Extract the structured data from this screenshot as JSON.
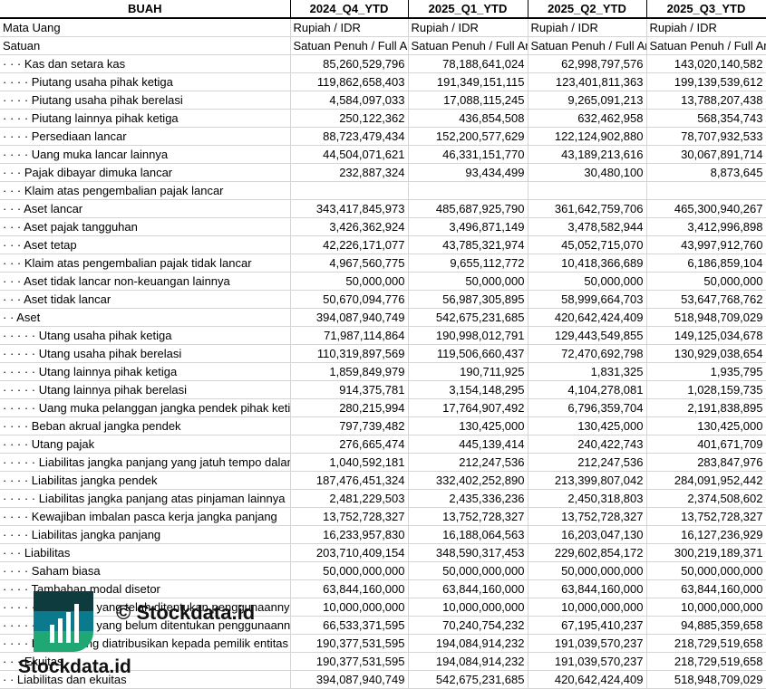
{
  "header": {
    "label": "BUAH",
    "periods": [
      "2024_Q4_YTD",
      "2025_Q1_YTD",
      "2025_Q2_YTD",
      "2025_Q3_YTD"
    ]
  },
  "meta_rows": [
    {
      "label": "Mata Uang",
      "values": [
        "Rupiah / IDR",
        "Rupiah / IDR",
        "Rupiah / IDR",
        "Rupiah / IDR"
      ]
    },
    {
      "label": "Satuan",
      "values": [
        "Satuan Penuh / Full Amount",
        "Satuan Penuh / Full Amount",
        "Satuan Penuh / Full Amount",
        "Satuan Penuh / Full Amount"
      ]
    }
  ],
  "rows": [
    {
      "label": "· · · Kas dan setara kas",
      "values": [
        "85,260,529,796",
        "78,188,641,024",
        "62,998,797,576",
        "143,020,140,582"
      ]
    },
    {
      "label": "· · · · Piutang usaha pihak ketiga",
      "values": [
        "119,862,658,403",
        "191,349,151,115",
        "123,401,811,363",
        "199,139,539,612"
      ]
    },
    {
      "label": "· · · · Piutang usaha pihak berelasi",
      "values": [
        "4,584,097,033",
        "17,088,115,245",
        "9,265,091,213",
        "13,788,207,438"
      ]
    },
    {
      "label": "· · · · Piutang lainnya pihak ketiga",
      "values": [
        "250,122,362",
        "436,854,508",
        "632,462,958",
        "568,354,743"
      ]
    },
    {
      "label": "· · · · Persediaan lancar",
      "values": [
        "88,723,479,434",
        "152,200,577,629",
        "122,124,902,880",
        "78,707,932,533"
      ]
    },
    {
      "label": "· · · · Uang muka lancar lainnya",
      "values": [
        "44,504,071,621",
        "46,331,151,770",
        "43,189,213,616",
        "30,067,891,714"
      ]
    },
    {
      "label": "· · · Pajak dibayar dimuka lancar",
      "values": [
        "232,887,324",
        "93,434,499",
        "30,480,100",
        "8,873,645"
      ]
    },
    {
      "label": "· · · Klaim atas pengembalian pajak lancar",
      "values": [
        "",
        "",
        "",
        ""
      ]
    },
    {
      "label": "· · · Aset lancar",
      "values": [
        "343,417,845,973",
        "485,687,925,790",
        "361,642,759,706",
        "465,300,940,267"
      ]
    },
    {
      "label": "· · · Aset pajak tangguhan",
      "values": [
        "3,426,362,924",
        "3,496,871,149",
        "3,478,582,944",
        "3,412,996,898"
      ]
    },
    {
      "label": "· · · Aset tetap",
      "values": [
        "42,226,171,077",
        "43,785,321,974",
        "45,052,715,070",
        "43,997,912,760"
      ]
    },
    {
      "label": "· · · Klaim atas pengembalian pajak tidak lancar",
      "values": [
        "4,967,560,775",
        "9,655,112,772",
        "10,418,366,689",
        "6,186,859,104"
      ]
    },
    {
      "label": "· · · Aset tidak lancar non-keuangan lainnya",
      "values": [
        "50,000,000",
        "50,000,000",
        "50,000,000",
        "50,000,000"
      ]
    },
    {
      "label": "· · · Aset tidak lancar",
      "values": [
        "50,670,094,776",
        "56,987,305,895",
        "58,999,664,703",
        "53,647,768,762"
      ]
    },
    {
      "label": "· · Aset",
      "values": [
        "394,087,940,749",
        "542,675,231,685",
        "420,642,424,409",
        "518,948,709,029"
      ]
    },
    {
      "label": "· · · · · Utang usaha pihak ketiga",
      "values": [
        "71,987,114,864",
        "190,998,012,791",
        "129,443,549,855",
        "149,125,034,678"
      ]
    },
    {
      "label": "· · · · · Utang usaha pihak berelasi",
      "values": [
        "110,319,897,569",
        "119,506,660,437",
        "72,470,692,798",
        "130,929,038,654"
      ]
    },
    {
      "label": "· · · · · Utang lainnya pihak ketiga",
      "values": [
        "1,859,849,979",
        "190,711,925",
        "1,831,325",
        "1,935,795"
      ]
    },
    {
      "label": "· · · · · Utang lainnya pihak berelasi",
      "values": [
        "914,375,781",
        "3,154,148,295",
        "4,104,278,081",
        "1,028,159,735"
      ]
    },
    {
      "label": "· · · · · Uang muka pelanggan jangka pendek pihak ketiga",
      "values": [
        "280,215,994",
        "17,764,907,492",
        "6,796,359,704",
        "2,191,838,895"
      ]
    },
    {
      "label": "· · · · Beban akrual jangka pendek",
      "values": [
        "797,739,482",
        "130,425,000",
        "130,425,000",
        "130,425,000"
      ]
    },
    {
      "label": "· · · · Utang pajak",
      "values": [
        "276,665,474",
        "445,139,414",
        "240,422,743",
        "401,671,709"
      ]
    },
    {
      "label": "· · · · · Liabilitas jangka panjang yang jatuh tempo dalam satu tahun",
      "values": [
        "1,040,592,181",
        "212,247,536",
        "212,247,536",
        "283,847,976"
      ]
    },
    {
      "label": "· · · · Liabilitas jangka pendek",
      "values": [
        "187,476,451,324",
        "332,402,252,890",
        "213,399,807,042",
        "284,091,952,442"
      ]
    },
    {
      "label": "· · · · · Liabilitas jangka panjang atas pinjaman lainnya",
      "values": [
        "2,481,229,503",
        "2,435,336,236",
        "2,450,318,803",
        "2,374,508,602"
      ]
    },
    {
      "label": "· · · · Kewajiban imbalan pasca kerja jangka panjang",
      "values": [
        "13,752,728,327",
        "13,752,728,327",
        "13,752,728,327",
        "13,752,728,327"
      ]
    },
    {
      "label": "· · · · Liabilitas jangka panjang",
      "values": [
        "16,233,957,830",
        "16,188,064,563",
        "16,203,047,130",
        "16,127,236,929"
      ]
    },
    {
      "label": "· · · Liabilitas",
      "values": [
        "203,710,409,154",
        "348,590,317,453",
        "229,602,854,172",
        "300,219,189,371"
      ]
    },
    {
      "label": "· · · · Saham biasa",
      "values": [
        "50,000,000,000",
        "50,000,000,000",
        "50,000,000,000",
        "50,000,000,000"
      ]
    },
    {
      "label": "· · · · Tambahan modal disetor",
      "values": [
        "63,844,160,000",
        "63,844,160,000",
        "63,844,160,000",
        "63,844,160,000"
      ]
    },
    {
      "label": "· · · · · Cadangan yang telah ditentukan penggunaannya",
      "values": [
        "10,000,000,000",
        "10,000,000,000",
        "10,000,000,000",
        "10,000,000,000"
      ]
    },
    {
      "label": "· · · · · Cadangan yang belum ditentukan penggunaannya",
      "values": [
        "66,533,371,595",
        "70,240,754,232",
        "67,195,410,237",
        "94,885,359,658"
      ]
    },
    {
      "label": "· · · · Ekuitas yang diatribusikan kepada pemilik entitas induk",
      "values": [
        "190,377,531,595",
        "194,084,914,232",
        "191,039,570,237",
        "218,729,519,658"
      ]
    },
    {
      "label": "· · · Ekuitas",
      "values": [
        "190,377,531,595",
        "194,084,914,232",
        "191,039,570,237",
        "218,729,519,658"
      ]
    },
    {
      "label": "· · Liabilitas dan ekuitas",
      "values": [
        "394,087,940,749",
        "542,675,231,685",
        "420,642,424,409",
        "518,948,709,029"
      ]
    }
  ],
  "watermark": {
    "text": "© Stockdata.id",
    "logo_text": "Stockdata.id",
    "colors": {
      "dark": "#0d3b3e",
      "teal": "#0b7a8c",
      "green": "#1fa774"
    }
  }
}
